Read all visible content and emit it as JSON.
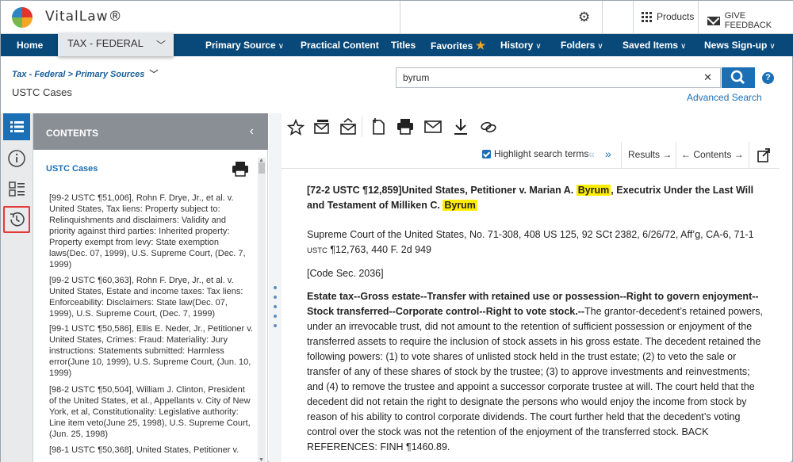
{
  "app": {
    "name": "VitalLaw®"
  },
  "header": {
    "products_label": "Products",
    "feedback_label": "GIVE FEEDBACK"
  },
  "nav": {
    "home": "Home",
    "library": "TAX - FEDERAL",
    "items": [
      "Primary Source",
      "Practical Content",
      "Titles",
      "Favorites",
      "History",
      "Folders",
      "Saved Items",
      "News Sign-up"
    ]
  },
  "breadcrumb": "Tax - Federal > Primary Sources",
  "page_title": "USTC Cases",
  "search": {
    "value": "byrum",
    "advanced_label": "Advanced Search"
  },
  "contents": {
    "header": "CONTENTS",
    "title": "USTC Cases",
    "items": [
      "[99-2 USTC ¶51,006], Rohn F. Drye, Jr., et al. v. United States, Tax liens: Property subject to: Relinquishments and disclaimers: Validity and priority against third parties: Inherited property: Property exempt from levy: State exemption laws(Dec. 07, 1999), U.S. Supreme Court, (Dec. 7, 1999)",
      "[99-2 USTC ¶60,363], Rohn F. Drye, Jr., et al. v. United States, Estate and income taxes: Tax liens: Enforceability: Disclaimers: State law(Dec. 07, 1999), U.S. Supreme Court, (Dec. 7, 1999)",
      "[99-1 USTC ¶50,586], Ellis E. Neder, Jr., Petitioner v. United States, Crimes: Fraud: Materiality: Jury instructions: Statements submitted: Harmless error(June 10, 1999), U.S. Supreme Court, (Jun. 10, 1999)",
      "[98-2 USTC ¶50,504], William J. Clinton, President of the United States, et al., Appellants v. City of New York, et al, Constitutionality: Legislative authority: Line item veto(June 25, 1998), U.S. Supreme Court, (Jun. 25, 1998)",
      "[98-1 USTC ¶50,368], United States, Petitioner v."
    ]
  },
  "toolbar": {
    "highlight_label": "Highlight search terms",
    "highlight_checked": true,
    "results_label": "Results",
    "contents_label": "Contents"
  },
  "document": {
    "title_pre": "[72-2 USTC ¶12,859]United States, Petitioner v. Marian A. ",
    "title_hit1": "Byrum",
    "title_mid": ", Executrix Under the Last Will and Testament of Milliken C. ",
    "title_hit2": "Byrum",
    "court_line_a": "Supreme Court of the United States, No. 71-308, 408 US 125, 92 SCt 2382, 6/26/72, Aff’g, CA-6, 71-1 ",
    "court_usc": "USTC",
    "court_line_b": " ¶12,763, 440 F. 2d 949",
    "code_sec": "[Code Sec. 2036]",
    "headnote_bold": "Estate tax--Gross estate--Transfer with retained use or possession--Right to govern enjoyment--Stock transferred--Corporate control--Right to vote stock.--",
    "headnote_body": "The grantor-decedent’s retained powers, under an irrevocable trust, did not amount to the retention of sufficient possession or enjoyment of the transferred assets to require the inclusion of stock assets in his gross estate. The decedent retained the following powers: (1) to vote shares of unlisted stock held in the trust estate; (2) to veto the sale or transfer of any of these shares of stock by the trustee; (3) to approve investments and reinvestments; and (4) to remove the trustee and appoint a successor corporate trustee at will. The court held that the decedent did not retain the right to designate the persons who would enjoy the income from stock by reason of his ability to control corporate dividends. The court further held that the decedent’s voting control over the stock was not the retention of the enjoyment of the transferred stock. BACK REFERENCES: FINH ¶1460.89."
  },
  "colors": {
    "nav_bg": "#08497a",
    "accent": "#1b6fb5",
    "highlight": "#ffee00"
  }
}
